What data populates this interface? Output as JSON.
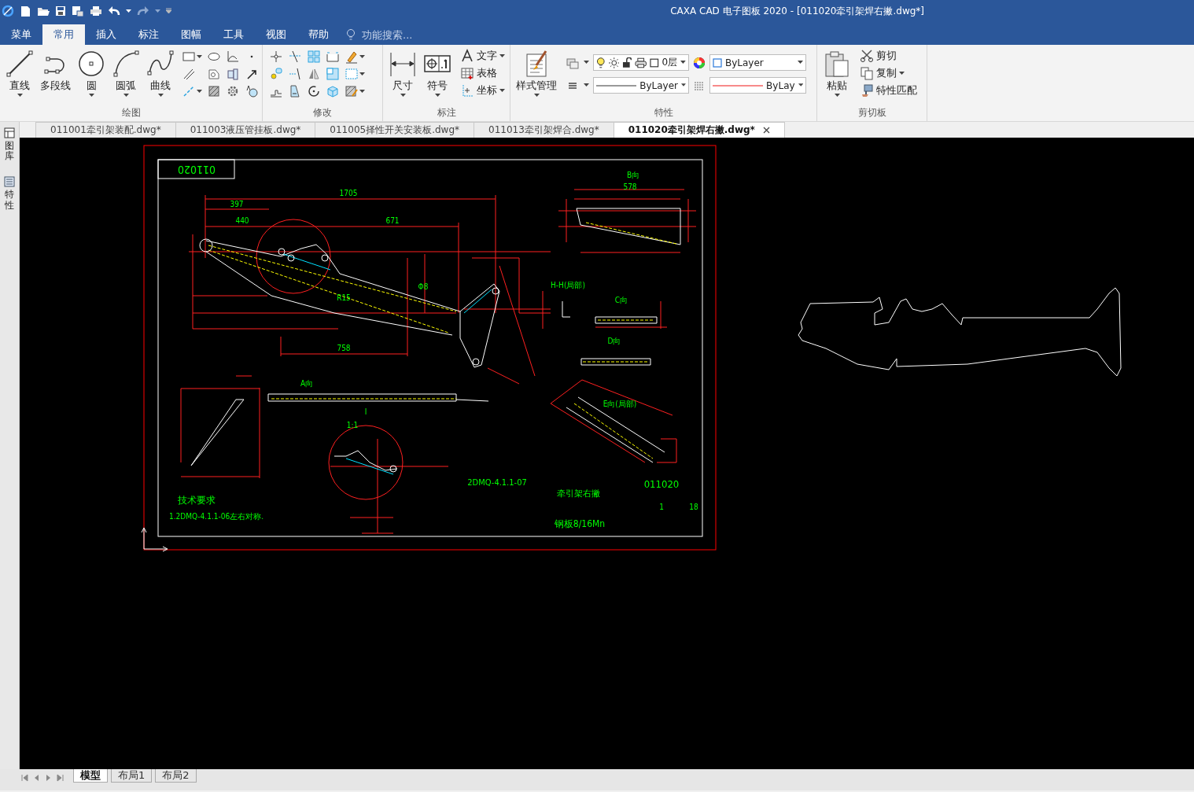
{
  "window": {
    "title": "CAXA CAD 电子图板 2020 - [011020牵引架焊右撇.dwg*]"
  },
  "menu_tabs": [
    {
      "label": "菜单",
      "selected": false
    },
    {
      "label": "常用",
      "selected": true
    },
    {
      "label": "插入",
      "selected": false
    },
    {
      "label": "标注",
      "selected": false
    },
    {
      "label": "图幅",
      "selected": false
    },
    {
      "label": "工具",
      "selected": false
    },
    {
      "label": "视图",
      "selected": false
    },
    {
      "label": "帮助",
      "selected": false
    }
  ],
  "search": {
    "placeholder": "功能搜索..."
  },
  "ribbon": {
    "groups": [
      {
        "label": "绘图",
        "kind": "draw",
        "buttons": [
          {
            "label": "直线",
            "dropdown": true
          },
          {
            "label": "多段线",
            "dropdown": false
          },
          {
            "label": "圆",
            "dropdown": true
          },
          {
            "label": "圆弧",
            "dropdown": true
          },
          {
            "label": "曲线",
            "dropdown": true
          }
        ]
      },
      {
        "label": "修改",
        "kind": "modify"
      },
      {
        "label": "标注",
        "kind": "annotate",
        "buttons": [
          {
            "label": "尺寸",
            "dropdown": true
          },
          {
            "label": "符号",
            "dropdown": true
          }
        ],
        "small_buttons": [
          {
            "label": "文字",
            "dropdown": true
          },
          {
            "label": "表格",
            "dropdown": false
          },
          {
            "label": "坐标",
            "dropdown": true
          }
        ]
      },
      {
        "label": "特性",
        "kind": "properties",
        "buttons": [
          {
            "label": "样式管理",
            "dropdown": true
          }
        ],
        "layer": "0层",
        "color_value": "ByLayer",
        "linetype": "ByLayer",
        "lineweight": "ByLay"
      },
      {
        "label": "剪切板",
        "kind": "clipboard",
        "buttons": [
          {
            "label": "粘贴",
            "dropdown": true
          }
        ],
        "small_buttons": [
          {
            "label": "剪切",
            "dropdown": false
          },
          {
            "label": "复制",
            "dropdown": true
          },
          {
            "label": "特性匹配",
            "dropdown": false
          }
        ]
      }
    ]
  },
  "side_panel": [
    {
      "label": "图库"
    },
    {
      "label": "特性"
    }
  ],
  "document_tabs": [
    {
      "label": "011001牵引架装配.dwg*",
      "selected": false
    },
    {
      "label": "011003液压管挂板.dwg*",
      "selected": false
    },
    {
      "label": "011005择性开关安装板.dwg*",
      "selected": false
    },
    {
      "label": "011013牵引架焊合.dwg*",
      "selected": false
    },
    {
      "label": "011020牵引架焊右撇.dwg*",
      "selected": true
    }
  ],
  "drawing": {
    "number_box": "011020",
    "labels": [
      {
        "text": "B向"
      },
      {
        "text": "578"
      },
      {
        "text": "1705"
      },
      {
        "text": "397"
      },
      {
        "text": "440"
      },
      {
        "text": "671"
      },
      {
        "text": "R15"
      },
      {
        "text": "Φ8"
      },
      {
        "text": "758"
      },
      {
        "text": "H-H(局部)"
      },
      {
        "text": "C向"
      },
      {
        "text": "D向"
      },
      {
        "text": "A向"
      },
      {
        "text": "I"
      },
      {
        "text": "1:1"
      },
      {
        "text": "E向(局部)"
      },
      {
        "text": "2DMQ-4.1.1-07"
      },
      {
        "text": "牵引架右撇"
      },
      {
        "text": "011020"
      },
      {
        "text": "技术要求"
      },
      {
        "text": "1.2DMQ-4.1.1-06左右对称."
      },
      {
        "text": "钢板8/16Mn"
      },
      {
        "text": "1"
      },
      {
        "text": "18"
      }
    ]
  },
  "layout_tabs": [
    {
      "label": "模型",
      "selected": true
    },
    {
      "label": "布局1",
      "selected": false
    },
    {
      "label": "布局2",
      "selected": false
    }
  ]
}
